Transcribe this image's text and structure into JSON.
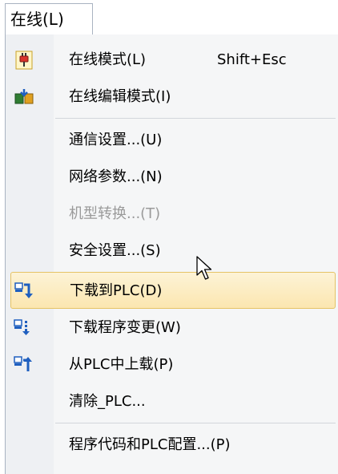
{
  "menubar": {
    "tab_label": "在线(L)"
  },
  "menu": {
    "items": [
      {
        "label": "在线模式(L)",
        "shortcut": "Shift+Esc",
        "icon": "online-mode-plug-icon",
        "enabled": true
      },
      {
        "label": "在线编辑模式(I)",
        "icon": "online-edit-mode-icon",
        "enabled": true
      },
      {
        "label": "通信设置...(U)",
        "enabled": true
      },
      {
        "label": "网络参数...(N)",
        "enabled": true
      },
      {
        "label": "机型转换...(T)",
        "enabled": false
      },
      {
        "label": "安全设置...(S)",
        "enabled": true
      },
      {
        "label": "下载到PLC(D)",
        "icon": "download-to-plc-icon",
        "enabled": true,
        "highlighted": true
      },
      {
        "label": "下载程序变更(W)",
        "icon": "download-program-changes-icon",
        "enabled": true
      },
      {
        "label": "从PLC中上载(P)",
        "icon": "upload-from-plc-icon",
        "enabled": true
      },
      {
        "label": "清除_PLC...",
        "enabled": true
      },
      {
        "label": "程序代码和PLC配置...(P)",
        "enabled": true
      }
    ]
  },
  "colors": {
    "highlight_fill": "#fbe6b0",
    "highlight_border": "#e5c365",
    "icon_blue": "#1f5fbf",
    "disabled_text": "#9a9a9a"
  }
}
